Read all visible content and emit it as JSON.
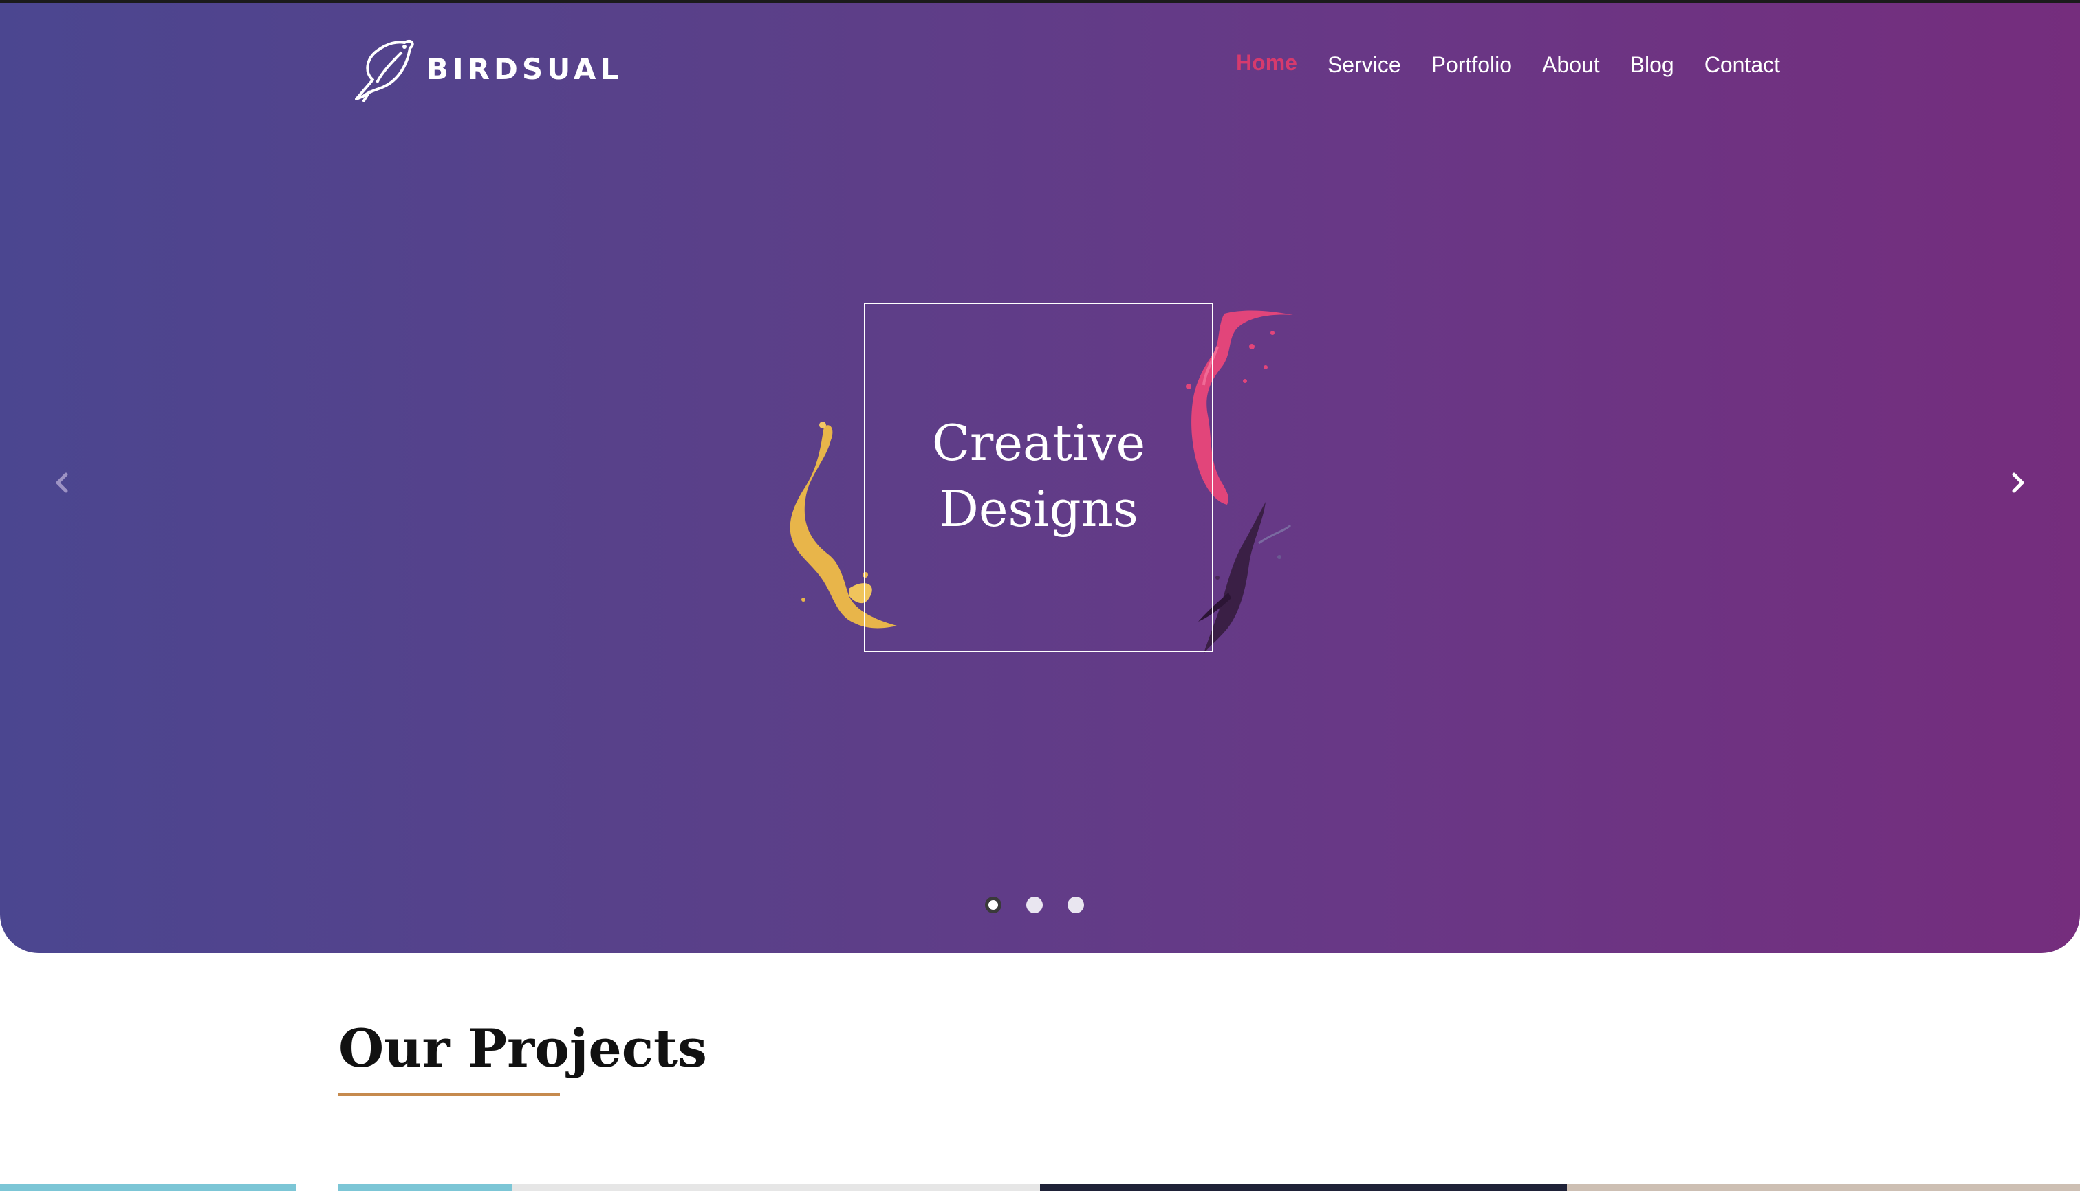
{
  "brand": {
    "name": "BIRDSUAL"
  },
  "nav": {
    "items": [
      {
        "label": "Home"
      },
      {
        "label": "Service"
      },
      {
        "label": "Portfolio"
      },
      {
        "label": "About"
      },
      {
        "label": "Blog"
      },
      {
        "label": "Contact"
      }
    ]
  },
  "hero": {
    "headline_line1": "Creative",
    "headline_line2": "Designs",
    "slides_total": 3,
    "active_slide": 1
  },
  "projects": {
    "title": "Our Projects"
  },
  "colors": {
    "gradient_start": "#4b4690",
    "gradient_end": "#752d7d",
    "nav_active": "#d63a6d",
    "underline": "#c68a4e"
  }
}
